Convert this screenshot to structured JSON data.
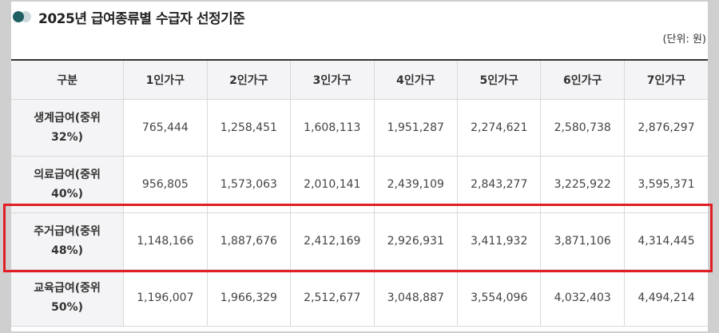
{
  "title": "2025년 급여종류별 수급자 선정기준",
  "unit": "(단위: 원)",
  "colors": {
    "dot_dark": "#1f5f64",
    "dot_light": "#cfd9dc",
    "highlight": "#e01e25",
    "header_bg": "#f4f4f6"
  },
  "table": {
    "headers": [
      "구분",
      "1인가구",
      "2인가구",
      "3인가구",
      "4인가구",
      "5인가구",
      "6인가구",
      "7인가구"
    ],
    "rows": [
      {
        "label_line1": "생계급여(중위",
        "label_line2": "32%)",
        "values": [
          "765,444",
          "1,258,451",
          "1,608,113",
          "1,951,287",
          "2,274,621",
          "2,580,738",
          "2,876,297"
        ]
      },
      {
        "label_line1": "의료급여(중위",
        "label_line2": "40%)",
        "values": [
          "956,805",
          "1,573,063",
          "2,010,141",
          "2,439,109",
          "2,843,277",
          "3,225,922",
          "3,595,371"
        ]
      },
      {
        "label_line1": "주거급여(중위",
        "label_line2": "48%)",
        "values": [
          "1,148,166",
          "1,887,676",
          "2,412,169",
          "2,926,931",
          "3,411,932",
          "3,871,106",
          "4,314,445"
        ]
      },
      {
        "label_line1": "교육급여(중위",
        "label_line2": "50%)",
        "values": [
          "1,196,007",
          "1,966,329",
          "2,512,677",
          "3,048,887",
          "3,554,096",
          "4,032,403",
          "4,494,214"
        ]
      }
    ]
  }
}
